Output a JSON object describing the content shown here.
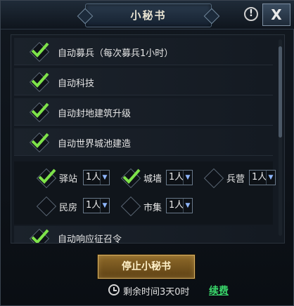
{
  "window": {
    "title": "小秘书",
    "help_icon": "help-icon",
    "close_label": "X"
  },
  "options": [
    {
      "label": "自动募兵（每次募兵1小时）",
      "checked": true
    },
    {
      "label": "自动科技",
      "checked": true
    },
    {
      "label": "自动封地建筑升级",
      "checked": true
    },
    {
      "label": "自动世界城池建造",
      "checked": true
    }
  ],
  "buildings": [
    {
      "label": "驿站",
      "checked": true,
      "value": "1人"
    },
    {
      "label": "城墙",
      "checked": true,
      "value": "1人"
    },
    {
      "label": "兵营",
      "checked": false,
      "value": "1人"
    },
    {
      "label": "民房",
      "checked": false,
      "value": "1人"
    },
    {
      "label": "市集",
      "checked": false,
      "value": "1人"
    }
  ],
  "last_option": {
    "label": "自动响应征召令",
    "checked": true
  },
  "footer": {
    "stop_label": "停止小秘书",
    "remaining": "剩余时间3天0时",
    "renew_label": "续费"
  },
  "colors": {
    "check": "#7ee24a",
    "renew": "#39d56a",
    "button_gold": "#8e6a2a"
  }
}
